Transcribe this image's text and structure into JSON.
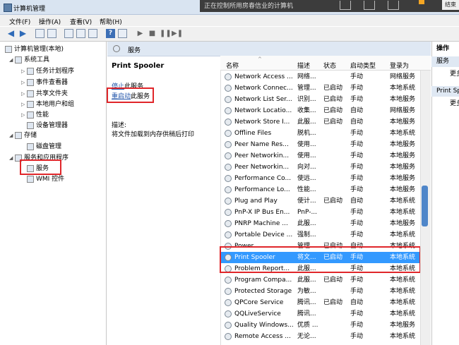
{
  "window": {
    "title": "计算机管理"
  },
  "overlay": {
    "text": "正在控制所用房春信业的计算机",
    "end_button": "结束"
  },
  "menu": {
    "items": [
      "文件(F)",
      "操作(A)",
      "查看(V)",
      "帮助(H)"
    ]
  },
  "tree": {
    "root": "计算机管理(本地)",
    "system_tools": "系统工具",
    "items": [
      "任务计划程序",
      "事件查看器",
      "共享文件夹",
      "本地用户和组",
      "性能",
      "设备管理器"
    ],
    "storage": "存储",
    "disk_mgmt": "磁盘管理",
    "services_apps": "服务和应用程序",
    "services": "服务",
    "wmi": "WMI 控件"
  },
  "pane": {
    "title": "服务"
  },
  "detail": {
    "service_name": "Print Spooler",
    "stop_link": "停止",
    "stop_suffix": "此服务",
    "restart_link": "重启动",
    "restart_suffix": "此服务",
    "desc_label": "描述:",
    "desc_text": "将文件加载到内存供稍后打印"
  },
  "columns": [
    "名称",
    "描述",
    "状态",
    "启动类型",
    "登录为"
  ],
  "rows": [
    [
      "Network Access ...",
      "网络...",
      "",
      "手动",
      "网络服务"
    ],
    [
      "Network Connec...",
      "管理...",
      "已启动",
      "手动",
      "本地系统"
    ],
    [
      "Network List Ser...",
      "识别...",
      "已启动",
      "手动",
      "本地服务"
    ],
    [
      "Network Locatio...",
      "收集...",
      "已启动",
      "自动",
      "网络服务"
    ],
    [
      "Network Store I...",
      "此服...",
      "已启动",
      "自动",
      "本地服务"
    ],
    [
      "Offline Files",
      "脱机...",
      "",
      "手动",
      "本地系统"
    ],
    [
      "Peer Name Res...",
      "使用...",
      "",
      "手动",
      "本地服务"
    ],
    [
      "Peer Networkin...",
      "使用...",
      "",
      "手动",
      "本地服务"
    ],
    [
      "Peer Networkin...",
      "向对...",
      "",
      "手动",
      "本地服务"
    ],
    [
      "Performance Co...",
      "使远...",
      "",
      "手动",
      "本地服务"
    ],
    [
      "Performance Lo...",
      "性能...",
      "",
      "手动",
      "本地服务"
    ],
    [
      "Plug and Play",
      "使计...",
      "已启动",
      "自动",
      "本地系统"
    ],
    [
      "PnP-X IP Bus En...",
      "PnP-...",
      "",
      "手动",
      "本地系统"
    ],
    [
      "PNRP Machine ...",
      "此服...",
      "",
      "手动",
      "本地服务"
    ],
    [
      "Portable Device ...",
      "强制...",
      "",
      "手动",
      "本地系统"
    ],
    [
      "Power",
      "管理...",
      "已启动",
      "自动",
      "本地系统"
    ],
    [
      "Print Spooler",
      "将文...",
      "已启动",
      "手动",
      "本地系统"
    ],
    [
      "Problem Report...",
      "此服...",
      "",
      "手动",
      "本地系统"
    ],
    [
      "Program Compa...",
      "此服...",
      "已启动",
      "手动",
      "本地系统"
    ],
    [
      "Protected Storage",
      "为敏...",
      "",
      "手动",
      "本地系统"
    ],
    [
      "QPCore Service",
      "腾讯...",
      "已启动",
      "自动",
      "本地系统"
    ],
    [
      "QQLiveService",
      "腾讯...",
      "",
      "手动",
      "本地系统"
    ],
    [
      "Quality Windows...",
      "优质 ...",
      "",
      "手动",
      "本地服务"
    ],
    [
      "Remote Access ...",
      "无论...",
      "",
      "手动",
      "本地系统"
    ]
  ],
  "actions": {
    "header": "操作",
    "group1": "服务",
    "item1": "更多操作",
    "group2": "Print Spooler",
    "item2": "更多操作"
  },
  "colors": {
    "selection": "#3399ff",
    "highlight_box": "#e0262a"
  }
}
